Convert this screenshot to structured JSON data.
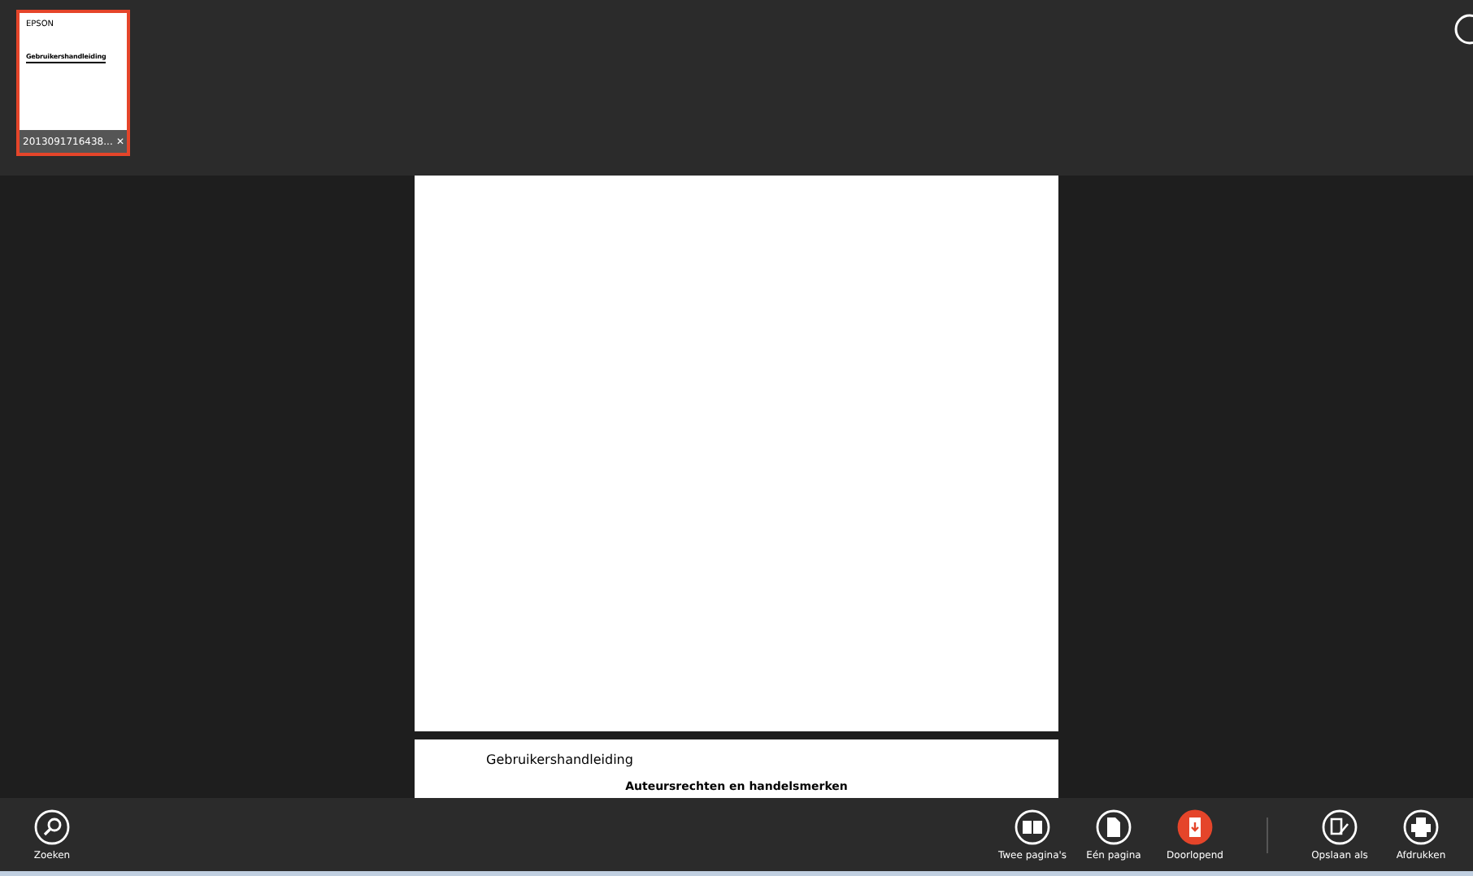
{
  "thumbnails": [
    {
      "brand": "EPSON",
      "title": "Gebruikershandleiding",
      "label": "2013091716438...",
      "close": "✕",
      "selected": true
    }
  ],
  "document": {
    "page_2_header": "Gebruikershandleiding",
    "page_2_heading": "Auteursrechten en handelsmerken"
  },
  "app_bar": {
    "left": [
      {
        "kind": "search",
        "label": "Zoeken"
      }
    ],
    "view_modes": [
      {
        "kind": "two-pages",
        "label": "Twee pagina's",
        "selected": false
      },
      {
        "kind": "one-page",
        "label": "Eén pagina",
        "selected": false
      },
      {
        "kind": "continuous",
        "label": "Doorlopend",
        "selected": true
      }
    ],
    "commands": [
      {
        "kind": "save-as",
        "label": "Opslaan als"
      },
      {
        "kind": "print",
        "label": "Afdrukken"
      }
    ]
  }
}
